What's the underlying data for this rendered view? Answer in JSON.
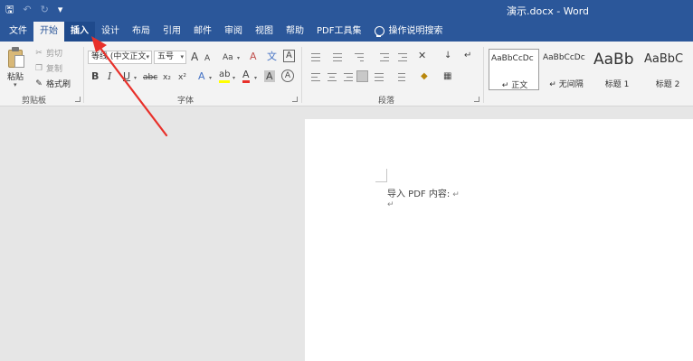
{
  "window": {
    "title": "演示.docx - Word"
  },
  "qat": {
    "save": "🖫",
    "undo": "↶",
    "redo": "↻",
    "customize": "▾"
  },
  "tabs": [
    "文件",
    "开始",
    "插入",
    "设计",
    "布局",
    "引用",
    "邮件",
    "审阅",
    "视图",
    "帮助",
    "PDF工具集"
  ],
  "tell_me": "操作说明搜索",
  "clipboard": {
    "paste": "粘贴",
    "cut": "剪切",
    "copy": "复制",
    "format_painter": "格式刷",
    "group": "剪贴板"
  },
  "font": {
    "font_name": "等线 (中文正文",
    "font_size": "五号",
    "grow": "A",
    "shrink": "A",
    "case": "Aa",
    "clear": "A",
    "char_border": "A",
    "bold": "B",
    "italic": "I",
    "underline": "U",
    "strike": "abc",
    "subscript": "x₂",
    "superscript": "x²",
    "effects": "A",
    "highlight": "ab",
    "color": "A",
    "shade": "A",
    "circle": "A",
    "group": "字体"
  },
  "paragraph": {
    "group": "段落"
  },
  "styles": {
    "items": [
      {
        "sample": "AaBbCcDc",
        "name": "↵ 正文"
      },
      {
        "sample": "AaBbCcDc",
        "name": "↵ 无间隔"
      },
      {
        "sample": "AaBb",
        "name": "标题 1"
      },
      {
        "sample": "AaBbC",
        "name": "标题 2"
      }
    ]
  },
  "document": {
    "line1": "导入 PDF 内容:",
    "pilcrow": "↵"
  },
  "colors": {
    "word_blue": "#2b579a",
    "annotation_red": "#e8302a",
    "highlight_yellow": "#ffff00",
    "font_red": "#e8302a"
  }
}
